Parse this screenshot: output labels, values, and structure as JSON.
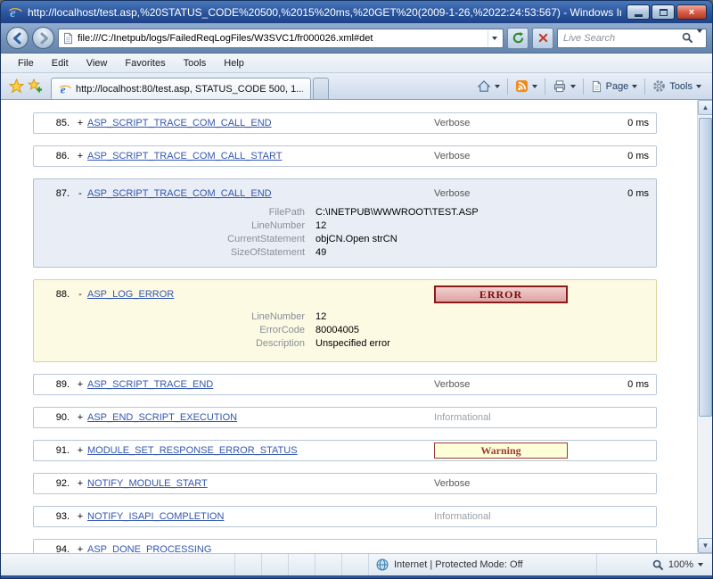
{
  "window": {
    "title": "http://localhost/test.asp,%20STATUS_CODE%20500,%2015%20ms,%20GET%20(2009-1-26,%2022:24:53:567) - Windows Intern...",
    "close_glyph": "×"
  },
  "nav": {
    "address": "file:///C:/Inetpub/logs/FailedReqLogFiles/W3SVC1/fr000026.xml#det",
    "search_placeholder": "Live Search"
  },
  "menu": {
    "items": [
      {
        "label": "File"
      },
      {
        "label": "Edit"
      },
      {
        "label": "View"
      },
      {
        "label": "Favorites"
      },
      {
        "label": "Tools"
      },
      {
        "label": "Help"
      }
    ]
  },
  "tabbar": {
    "tab_title": "http://localhost:80/test.asp, STATUS_CODE 500, 1...",
    "page_label": "Page",
    "tools_label": "Tools"
  },
  "events": [
    {
      "num": "85.",
      "toggle": "+",
      "name": "ASP_SCRIPT_TRACE_COM_CALL_END",
      "level": "Verbose",
      "duration": "0 ms"
    },
    {
      "num": "86.",
      "toggle": "+",
      "name": "ASP_SCRIPT_TRACE_COM_CALL_START",
      "level": "Verbose",
      "duration": "0 ms"
    },
    {
      "num": "87.",
      "toggle": "-",
      "name": "ASP_SCRIPT_TRACE_COM_CALL_END",
      "level": "Verbose",
      "duration": "0 ms",
      "properties": [
        {
          "label": "FilePath",
          "value": "C:\\INETPUB\\WWWROOT\\TEST.ASP"
        },
        {
          "label": "LineNumber",
          "value": "12"
        },
        {
          "label": "CurrentStatement",
          "value": "objCN.Open strCN"
        },
        {
          "label": "SizeOfStatement",
          "value": "49"
        }
      ]
    },
    {
      "num": "88.",
      "toggle": "-",
      "name": "ASP_LOG_ERROR",
      "badge": "ERROR",
      "properties": [
        {
          "label": "LineNumber",
          "value": "12"
        },
        {
          "label": "ErrorCode",
          "value": "80004005"
        },
        {
          "label": "Description",
          "value": "Unspecified error"
        }
      ]
    },
    {
      "num": "89.",
      "toggle": "+",
      "name": "ASP_SCRIPT_TRACE_END",
      "level": "Verbose",
      "duration": "0 ms"
    },
    {
      "num": "90.",
      "toggle": "+",
      "name": "ASP_END_SCRIPT_EXECUTION",
      "level": "Informational"
    },
    {
      "num": "91.",
      "toggle": "+",
      "name": "MODULE_SET_RESPONSE_ERROR_STATUS",
      "badge": "Warning"
    },
    {
      "num": "92.",
      "toggle": "+",
      "name": "NOTIFY_MODULE_START",
      "level": "Verbose"
    },
    {
      "num": "93.",
      "toggle": "+",
      "name": "NOTIFY_ISAPI_COMPLETION",
      "level": "Informational"
    },
    {
      "num": "94.",
      "toggle": "+",
      "name": "ASP_DONE_PROCESSING"
    }
  ],
  "scrollbar": {
    "up": "▲",
    "down": "▼"
  },
  "statusbar": {
    "zone": "Internet | Protected Mode: Off",
    "zoom": "100%"
  }
}
